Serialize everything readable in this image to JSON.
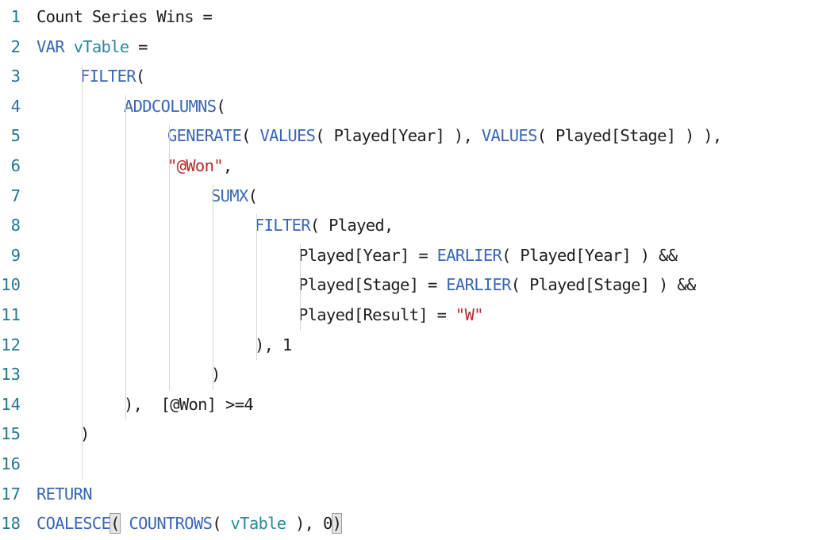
{
  "editor": {
    "language": "DAX",
    "colors": {
      "line_number": "#237893",
      "keyword": "#3a66b5",
      "variable": "#288a9e",
      "string": "#b52a2a",
      "text": "#1e1e1e"
    },
    "lines": [
      {
        "n": "1",
        "indent": 0,
        "tokens": [
          {
            "t": "Count Series Wins =",
            "c": ""
          }
        ]
      },
      {
        "n": "2",
        "indent": 0,
        "tokens": [
          {
            "t": "VAR",
            "c": "kw"
          },
          {
            "t": " ",
            "c": ""
          },
          {
            "t": "vTable",
            "c": "var"
          },
          {
            "t": " =",
            "c": ""
          }
        ]
      },
      {
        "n": "3",
        "indent": 1,
        "tokens": [
          {
            "t": "FILTER",
            "c": "fn"
          },
          {
            "t": "(",
            "c": ""
          }
        ]
      },
      {
        "n": "4",
        "indent": 2,
        "tokens": [
          {
            "t": "ADDCOLUMNS",
            "c": "fn"
          },
          {
            "t": "(",
            "c": ""
          }
        ]
      },
      {
        "n": "5",
        "indent": 3,
        "tokens": [
          {
            "t": "GENERATE",
            "c": "fn"
          },
          {
            "t": "( ",
            "c": ""
          },
          {
            "t": "VALUES",
            "c": "fn"
          },
          {
            "t": "( Played[Year] ), ",
            "c": ""
          },
          {
            "t": "VALUES",
            "c": "fn"
          },
          {
            "t": "( Played[Stage] ) ),",
            "c": ""
          }
        ]
      },
      {
        "n": "6",
        "indent": 3,
        "tokens": [
          {
            "t": "\"@Won\"",
            "c": "str"
          },
          {
            "t": ",",
            "c": ""
          }
        ]
      },
      {
        "n": "7",
        "indent": 4,
        "tokens": [
          {
            "t": "SUMX",
            "c": "fn"
          },
          {
            "t": "(",
            "c": ""
          }
        ]
      },
      {
        "n": "8",
        "indent": 5,
        "tokens": [
          {
            "t": "FILTER",
            "c": "fn"
          },
          {
            "t": "( Played,",
            "c": ""
          }
        ]
      },
      {
        "n": "9",
        "indent": 6,
        "tokens": [
          {
            "t": "Played[Year] = ",
            "c": ""
          },
          {
            "t": "EARLIER",
            "c": "fn"
          },
          {
            "t": "( Played[Year] ) &&",
            "c": ""
          }
        ]
      },
      {
        "n": "10",
        "indent": 6,
        "tokens": [
          {
            "t": "Played[Stage] = ",
            "c": ""
          },
          {
            "t": "EARLIER",
            "c": "fn"
          },
          {
            "t": "( Played[Stage] ) &&",
            "c": ""
          }
        ]
      },
      {
        "n": "11",
        "indent": 6,
        "tokens": [
          {
            "t": "Played[Result] = ",
            "c": ""
          },
          {
            "t": "\"W\"",
            "c": "str"
          }
        ]
      },
      {
        "n": "12",
        "indent": 5,
        "tokens": [
          {
            "t": "), 1",
            "c": ""
          }
        ]
      },
      {
        "n": "13",
        "indent": 4,
        "tokens": [
          {
            "t": ")",
            "c": ""
          }
        ]
      },
      {
        "n": "14",
        "indent": 2,
        "tokens": [
          {
            "t": "),  [@Won] >=4",
            "c": ""
          }
        ]
      },
      {
        "n": "15",
        "indent": 1,
        "tokens": [
          {
            "t": ")",
            "c": ""
          }
        ]
      },
      {
        "n": "16",
        "indent": 0,
        "tokens": []
      },
      {
        "n": "17",
        "indent": 0,
        "tokens": [
          {
            "t": "RETURN",
            "c": "kw"
          }
        ]
      },
      {
        "n": "18",
        "indent": 0,
        "tokens": [
          {
            "t": "COALESCE",
            "c": "fn"
          },
          {
            "t": "(",
            "c": "br"
          },
          {
            "t": " ",
            "c": ""
          },
          {
            "t": "COUNTROWS",
            "c": "fn"
          },
          {
            "t": "( ",
            "c": ""
          },
          {
            "t": "vTable",
            "c": "var"
          },
          {
            "t": " ), 0",
            "c": ""
          },
          {
            "t": ")",
            "c": "br"
          }
        ]
      }
    ]
  }
}
